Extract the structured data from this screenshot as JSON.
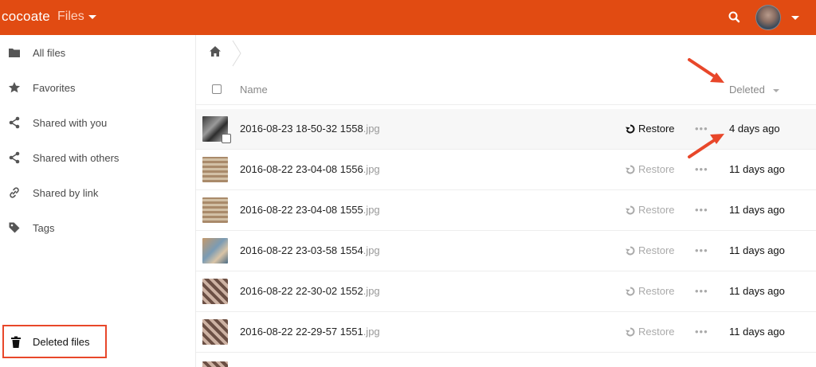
{
  "header": {
    "brand": "cocoate",
    "app_name": "Files",
    "accent_color": "#e14b12",
    "search_icon": "search-icon",
    "avatar_icon": "user-avatar"
  },
  "sidebar": {
    "items": [
      {
        "label": "All files",
        "icon": "folder-icon"
      },
      {
        "label": "Favorites",
        "icon": "star-icon"
      },
      {
        "label": "Shared with you",
        "icon": "share-icon"
      },
      {
        "label": "Shared with others",
        "icon": "share-icon"
      },
      {
        "label": "Shared by link",
        "icon": "link-icon"
      },
      {
        "label": "Tags",
        "icon": "tag-icon"
      }
    ],
    "deleted_files": {
      "label": "Deleted files",
      "icon": "trash-icon",
      "highlight_color": "#e8472a"
    }
  },
  "main": {
    "breadcrumb": {
      "icon": "home-icon"
    },
    "columns": {
      "name": "Name",
      "deleted": "Deleted"
    },
    "files": [
      {
        "name": "2016-08-23 18-50-32 1558",
        "ext": ".jpg",
        "action": "Restore",
        "deleted": "4 days ago"
      },
      {
        "name": "2016-08-22 23-04-08 1556",
        "ext": ".jpg",
        "action": "Restore",
        "deleted": "11 days ago"
      },
      {
        "name": "2016-08-22 23-04-08 1555",
        "ext": ".jpg",
        "action": "Restore",
        "deleted": "11 days ago"
      },
      {
        "name": "2016-08-22 23-03-58 1554",
        "ext": ".jpg",
        "action": "Restore",
        "deleted": "11 days ago"
      },
      {
        "name": "2016-08-22 22-30-02 1552",
        "ext": ".jpg",
        "action": "Restore",
        "deleted": "11 days ago"
      },
      {
        "name": "2016-08-22 22-29-57 1551",
        "ext": ".jpg",
        "action": "Restore",
        "deleted": "11 days ago"
      }
    ],
    "more_label": "•••"
  },
  "annotations": {
    "arrow_color": "#e8472a"
  }
}
